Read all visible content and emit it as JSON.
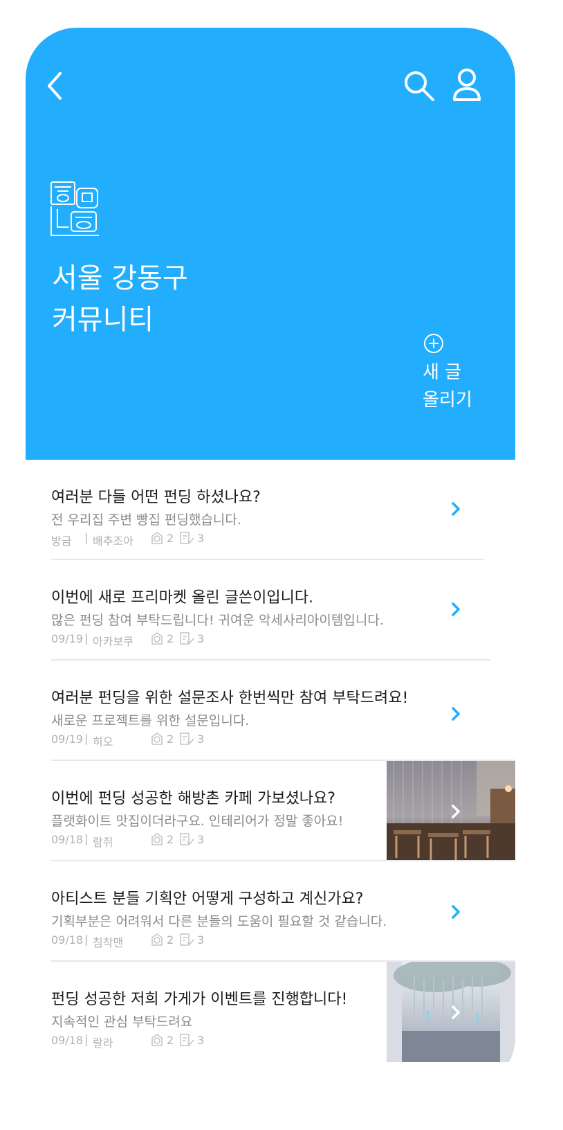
{
  "app": {
    "colors": {
      "accent": "#22aefc",
      "chevron": "#22aefc",
      "title": "#1b1b1b",
      "sub": "#8a8a8a",
      "meta": "#b0b0b0"
    },
    "icons": {
      "back": "chevron-left-icon",
      "search": "search-icon",
      "user": "user-icon",
      "new": "plus-circle-icon"
    }
  },
  "header": {
    "title_line1": "서울 강동구",
    "title_line2": "커뮤니티",
    "new_post_line1": "새 글",
    "new_post_line2": "올리기"
  },
  "posts": [
    {
      "title": "여러분 다들 어떤 펀딩 하셨나요?",
      "desc": "전 우리집 주변 빵집 펀딩했습니다.",
      "date": "방금",
      "author": "배추조아",
      "likes": "2",
      "comments": "3"
    },
    {
      "title": "이번에 새로 프리마켓 올린 글쓴이입니다.",
      "desc": "많은 펀딩 참여 부탁드립니다! 귀여운 악세사리아이템입니다.",
      "date": "09/19",
      "author": "아카보쿠",
      "likes": "2",
      "comments": "3"
    },
    {
      "title": "여러분 펀딩을 위한 설문조사 한번씩만 참여 부탁드려요!",
      "desc": "새로운 프로젝트를 위한 설문입니다.",
      "date": "09/19",
      "author": "히오",
      "likes": "2",
      "comments": "3"
    },
    {
      "title": "이번에 펀딩 성공한 해방촌 카페 가보셨나요?",
      "desc": "플랫화이트 맛집이더라구요. 인테리어가 정말 좋아요!",
      "date": "09/18",
      "author": "람쥐",
      "likes": "2",
      "comments": "3"
    },
    {
      "title": "아티스트 분들 기획안 어떻게 구성하고 계신가요?",
      "desc": "기획부분은 어려워서 다른 분들의 도움이 필요할 것 같습니다.",
      "date": "09/18",
      "author": "침착맨",
      "likes": "2",
      "comments": "3"
    },
    {
      "title": "펀딩 성공한 저희 가게가 이벤트를 진행합니다!",
      "desc": "지속적인 관심 부탁드려요",
      "date": "09/18",
      "author": "랄라",
      "likes": "2",
      "comments": "3"
    }
  ],
  "meta_separator": "|"
}
